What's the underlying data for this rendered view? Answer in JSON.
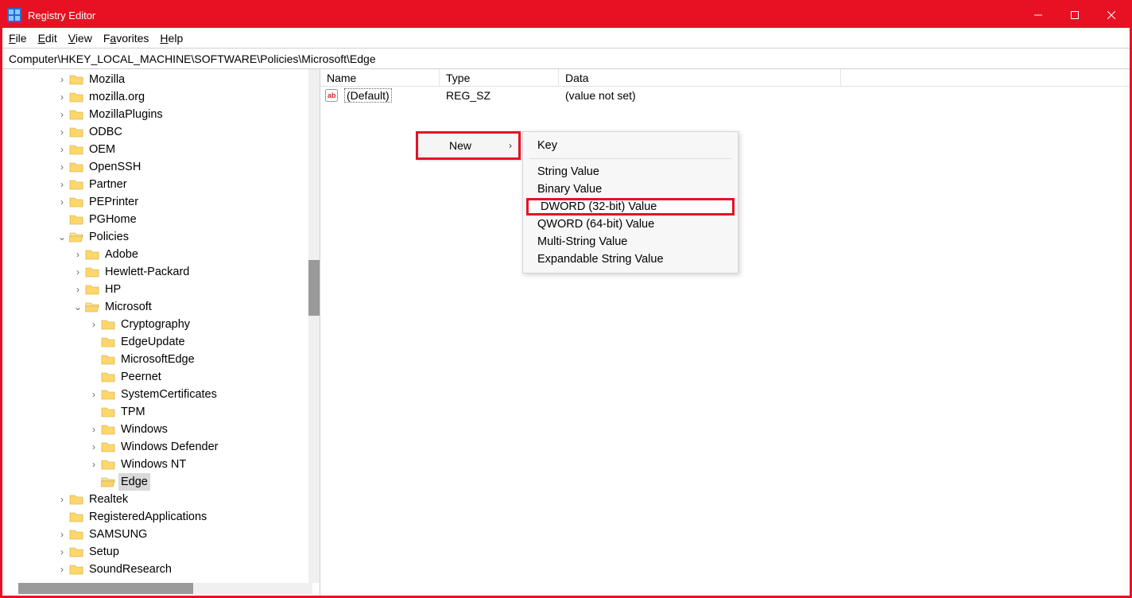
{
  "title": "Registry Editor",
  "menus": {
    "file": "File",
    "edit": "Edit",
    "view": "View",
    "favorites": "Favorites",
    "help": "Help"
  },
  "address": "Computer\\HKEY_LOCAL_MACHINE\\SOFTWARE\\Policies\\Microsoft\\Edge",
  "columns": {
    "name": "Name",
    "type": "Type",
    "data": "Data"
  },
  "rows": [
    {
      "name": "(Default)",
      "type": "REG_SZ",
      "data": "(value not set)"
    }
  ],
  "tree": {
    "n0": "Mozilla",
    "n1": "mozilla.org",
    "n2": "MozillaPlugins",
    "n3": "ODBC",
    "n4": "OEM",
    "n5": "OpenSSH",
    "n6": "Partner",
    "n7": "PEPrinter",
    "n8": "PGHome",
    "n9": "Policies",
    "p0": "Adobe",
    "p1": "Hewlett-Packard",
    "p2": "HP",
    "p3": "Microsoft",
    "m0": "Cryptography",
    "m1": "EdgeUpdate",
    "m2": "MicrosoftEdge",
    "m3": "Peernet",
    "m4": "SystemCertificates",
    "m5": "TPM",
    "m6": "Windows",
    "m7": "Windows Defender",
    "m8": "Windows NT",
    "m9": "Edge",
    "a0": "Realtek",
    "a1": "RegisteredApplications",
    "a2": "SAMSUNG",
    "a3": "Setup",
    "a4": "SoundResearch"
  },
  "ctx": {
    "new": "New",
    "items": {
      "key": "Key",
      "string": "String Value",
      "binary": "Binary Value",
      "dword": "DWORD (32-bit) Value",
      "qword": "QWORD (64-bit) Value",
      "multi": "Multi-String Value",
      "expand": "Expandable String Value"
    }
  }
}
